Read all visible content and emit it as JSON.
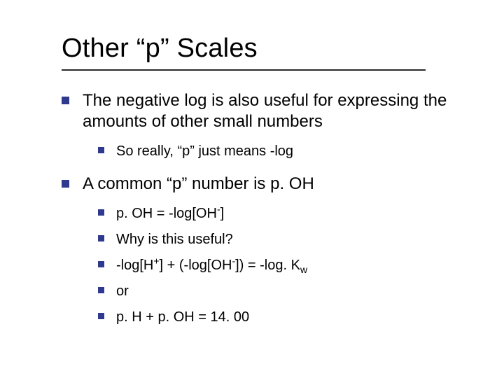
{
  "slide": {
    "title": "Other “p” Scales",
    "bullets": [
      {
        "text": "The negative log is also useful for expressing the amounts of other small numbers",
        "children": [
          {
            "text": "So really, “p” just means -log"
          }
        ]
      },
      {
        "text": "A common “p” number is p. OH",
        "children": [
          {
            "text_html": "p. OH = -log[OH<sup>-</sup>]",
            "text": "p. OH = -log[OH-]"
          },
          {
            "text": "Why is this useful?"
          },
          {
            "text_html": "-log[H<sup>+</sup>] + (-log[OH<sup>-</sup>]) = -log. K<sub>w</sub>",
            "text": "-log[H+] + (-log[OH-]) = -log. Kw"
          },
          {
            "text": "or"
          },
          {
            "text": "p. H + p. OH = 14. 00"
          }
        ]
      }
    ]
  }
}
